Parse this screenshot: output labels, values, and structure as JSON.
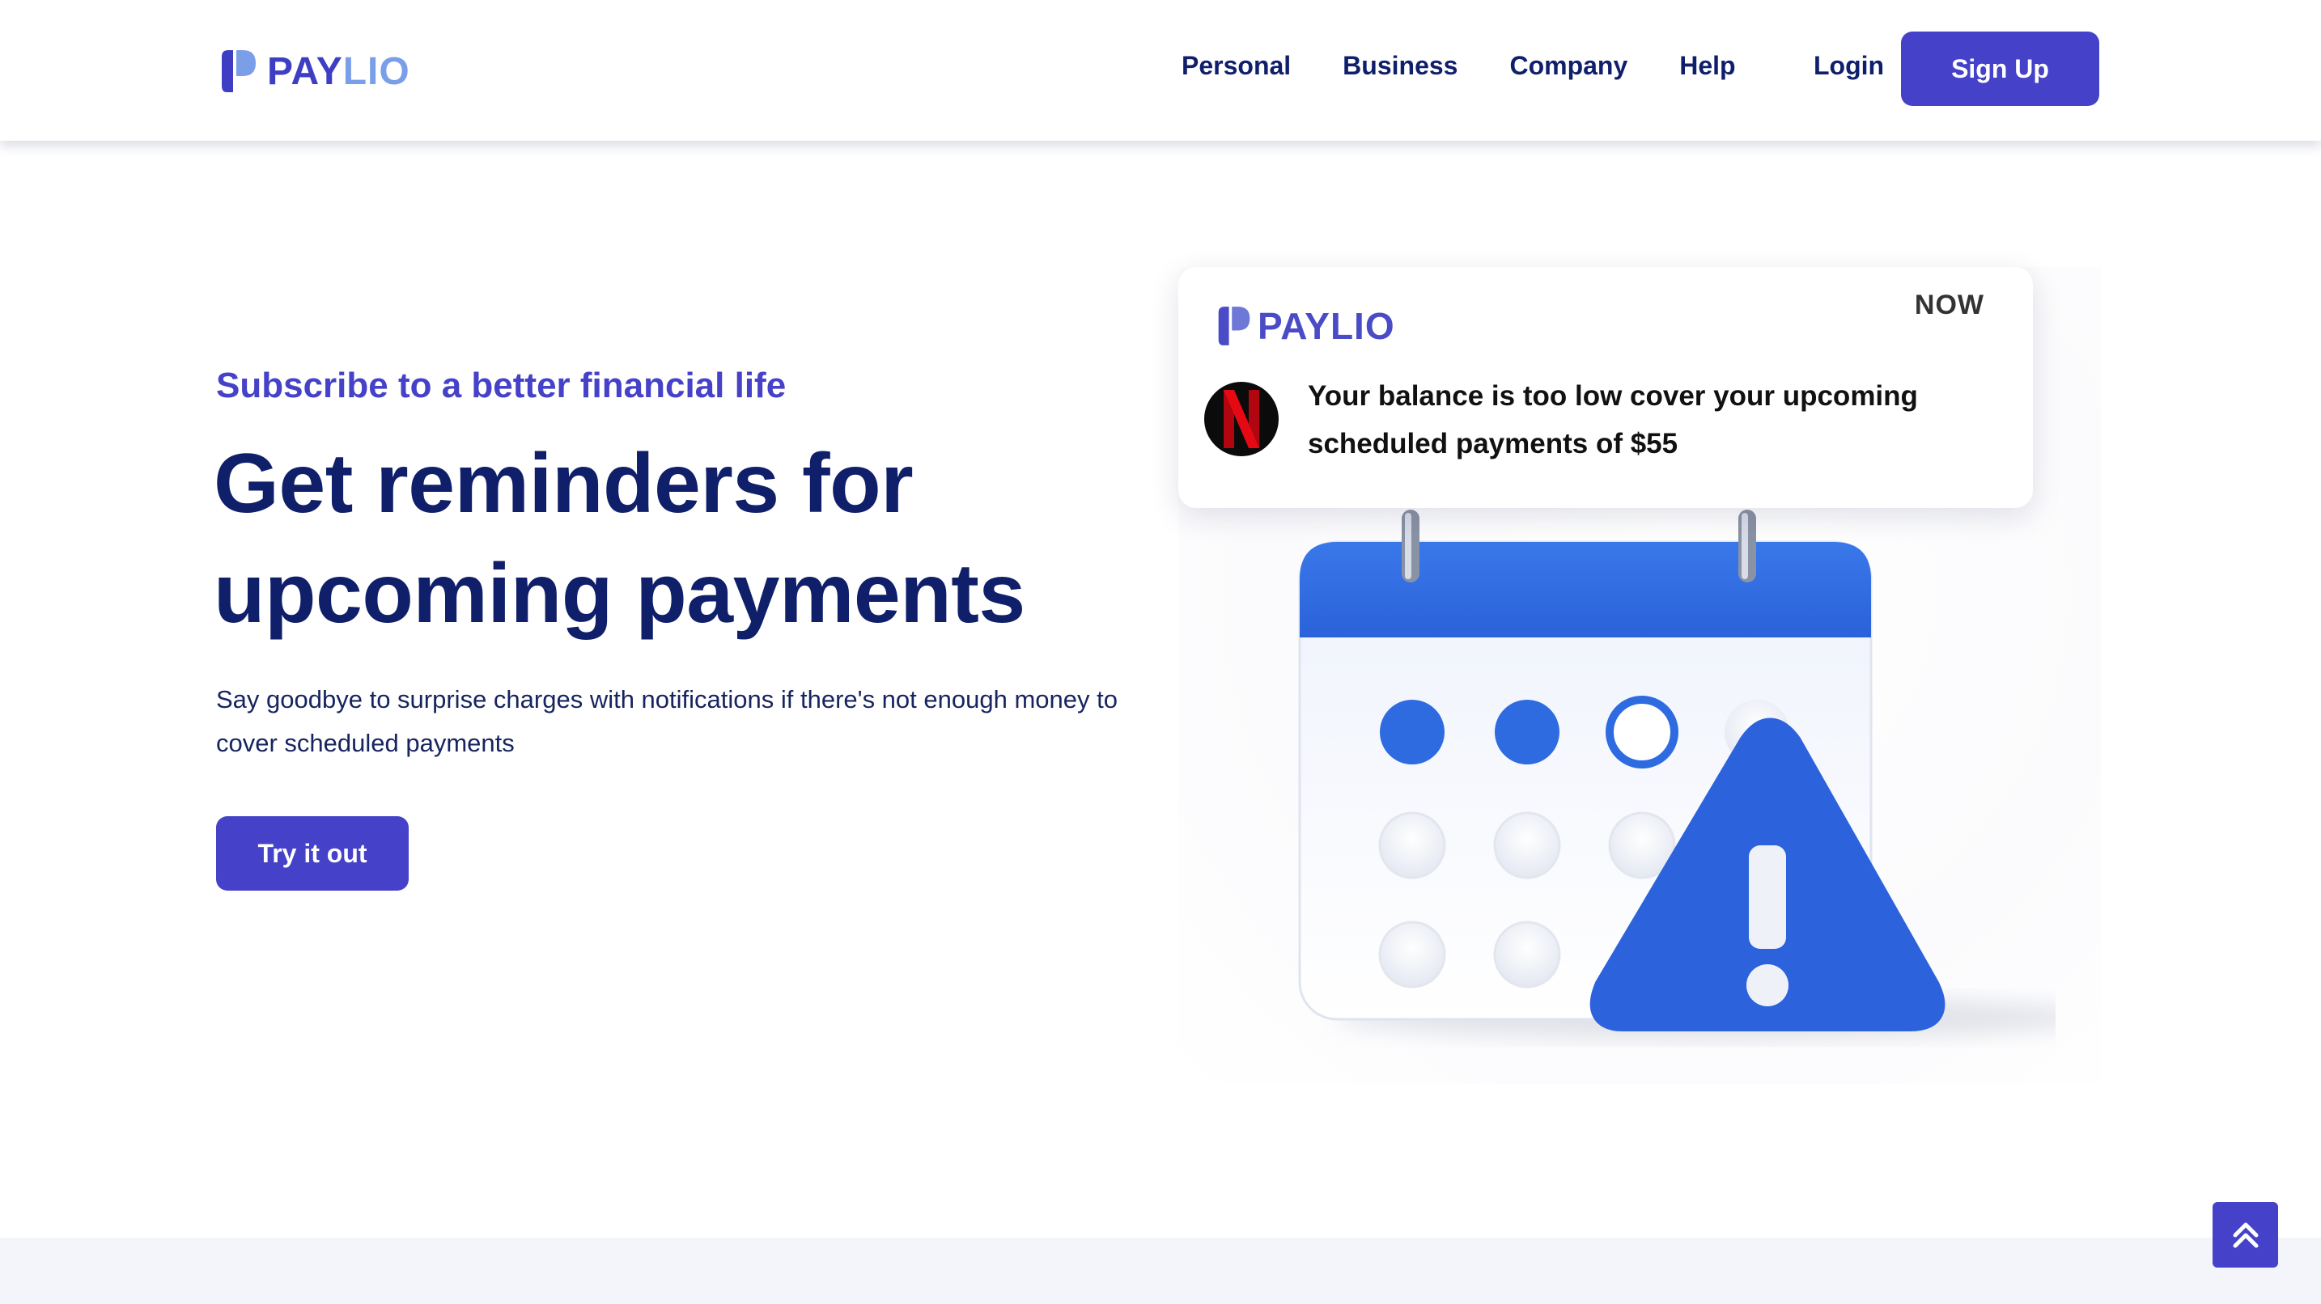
{
  "brand": {
    "name_part1": "PAY",
    "name_part2": "LIO",
    "primary_color": "#4541c9",
    "accent_color": "#7a9ee8",
    "text_color": "#101f6a"
  },
  "nav": {
    "links": [
      {
        "label": "Personal"
      },
      {
        "label": "Business"
      },
      {
        "label": "Company"
      },
      {
        "label": "Help"
      }
    ],
    "login_label": "Login",
    "signup_label": "Sign Up"
  },
  "hero": {
    "tagline": "Subscribe to a better financial life",
    "headline_line1": "Get reminders for",
    "headline_line2": "upcoming payments",
    "subtext": "Say goodbye to surprise charges with notifications if there's not enough money to cover scheduled payments",
    "cta_label": "Try it out"
  },
  "notification": {
    "brand_part1": "PAY",
    "brand_part2": "LIO",
    "time": "NOW",
    "app_icon": "netflix-icon",
    "message_line1": "Your balance is too low cover your upcoming",
    "message_line2": "scheduled payments of $55"
  },
  "illustration": {
    "calendar_color": "#2f6be0",
    "warning_icon": "warning-triangle-icon"
  },
  "scroll_top": {
    "icon": "double-chevron-up-icon"
  }
}
